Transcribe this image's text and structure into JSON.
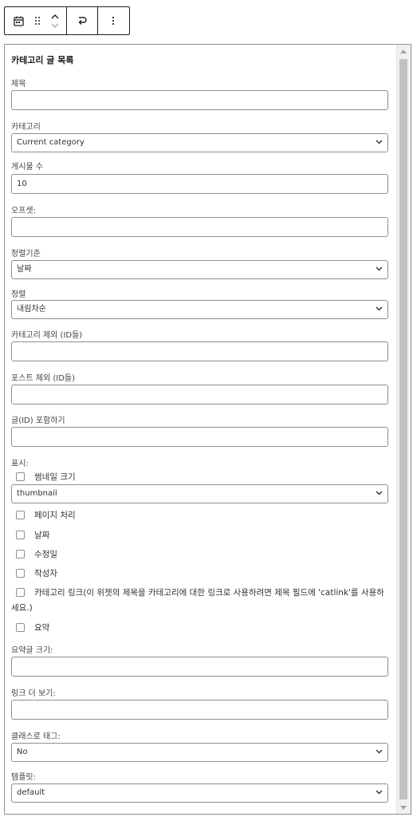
{
  "toolbar": {
    "block_icon": "calendar-icon",
    "drag_icon": "drag-handle-icon",
    "move_up_icon": "chevron-up-icon",
    "move_down_icon": "chevron-down-icon",
    "transform_icon": "transform-icon",
    "options_icon": "more-vertical-icon"
  },
  "widget": {
    "title": "카테고리 글 목록",
    "fields": {
      "title_label": "제목",
      "title_value": "",
      "category_label": "카테고리",
      "category_value": "Current category",
      "post_count_label": "게시물 수",
      "post_count_value": "10",
      "offset_label": "오프셋:",
      "offset_value": "",
      "orderby_label": "정렬기준",
      "orderby_value": "날짜",
      "order_label": "정렬",
      "order_value": "내림차순",
      "exclude_cats_label": "카테고리 제외 (ID들)",
      "exclude_cats_value": "",
      "exclude_posts_label": "포스트 제외 (ID들)",
      "exclude_posts_value": "",
      "include_posts_label": "글(ID) 포함하기",
      "include_posts_value": "",
      "display_label": "표시:",
      "thumbnail_size_label": "썸네일 크기",
      "thumbnail_size_value": "thumbnail",
      "pagination_label": "페이지 처리",
      "date_label": "날짜",
      "modified_label": "수정일",
      "author_label": "작성자",
      "category_link_label": "카테고리 링크(이 위젯의 제목을 카테고리에 대한 링크로 사용하려면 제목 필드에 'catlink'를 사용하세요.)",
      "excerpt_label": "요약",
      "excerpt_size_label": "요약글 크기:",
      "excerpt_size_value": "",
      "more_link_label": "링크 더 보기:",
      "more_link_value": "",
      "class_tag_label": "클래스로 태그:",
      "class_tag_value": "No",
      "template_label": "템플릿:",
      "template_value": "default"
    }
  },
  "scrollbar": {
    "up_icon": "scroll-up-arrow-icon",
    "down_icon": "scroll-down-arrow-icon"
  }
}
